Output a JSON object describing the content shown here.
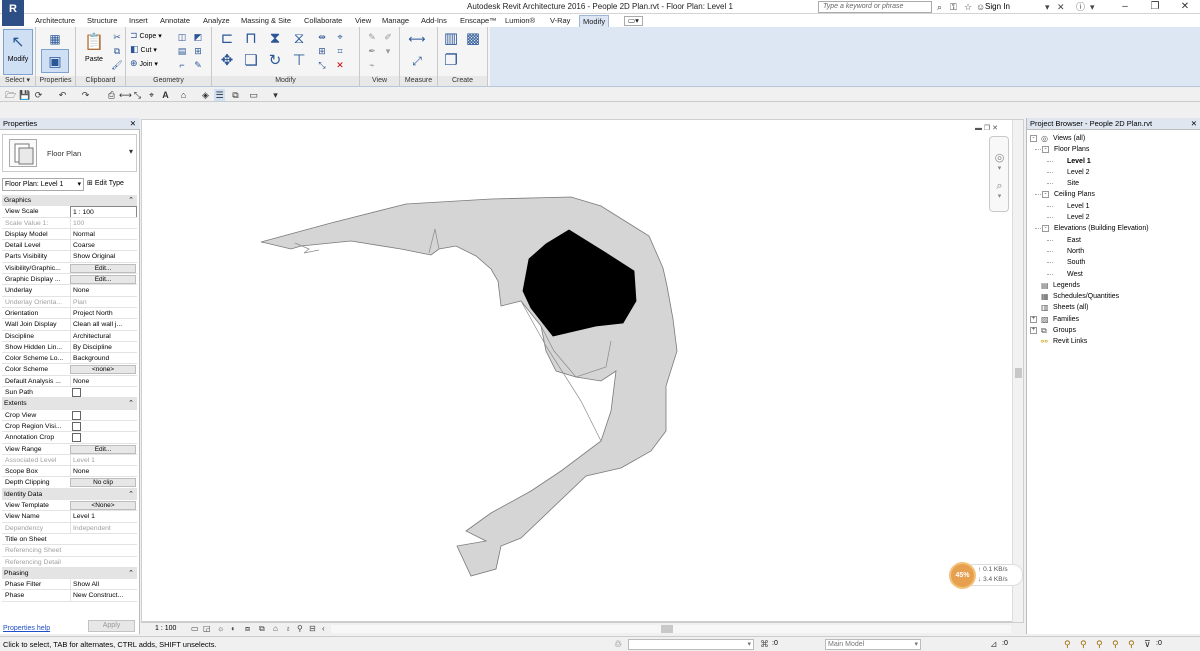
{
  "window": {
    "title": "Autodesk Revit Architecture 2016 -    People 2D Plan.rvt - Floor Plan: Level 1",
    "logo": "R",
    "search_placeholder": "Type a keyword or phrase",
    "sign_in": "Sign In"
  },
  "ribbon_tabs": [
    {
      "label": "Architecture",
      "active": false
    },
    {
      "label": "Structure",
      "active": false
    },
    {
      "label": "Insert",
      "active": false
    },
    {
      "label": "Annotate",
      "active": false
    },
    {
      "label": "Analyze",
      "active": false
    },
    {
      "label": "Massing & Site",
      "active": false
    },
    {
      "label": "Collaborate",
      "active": false
    },
    {
      "label": "View",
      "active": false
    },
    {
      "label": "Manage",
      "active": false
    },
    {
      "label": "Add-Ins",
      "active": false
    },
    {
      "label": "Enscape™",
      "active": false
    },
    {
      "label": "Lumion®",
      "active": false
    },
    {
      "label": "V-Ray",
      "active": false
    },
    {
      "label": "Modify",
      "active": true
    }
  ],
  "ribbon": {
    "modify_label": "Modify",
    "paste_label": "Paste",
    "cope_label": "Cope",
    "cut_label": "Cut",
    "join_label": "Join",
    "groups": {
      "select": "Select",
      "properties": "Properties",
      "clipboard": "Clipboard",
      "geometry": "Geometry",
      "modify": "Modify",
      "view": "View",
      "measure": "Measure",
      "create": "Create"
    }
  },
  "properties": {
    "title": "Properties",
    "type_name": "Floor Plan",
    "instance": "Floor Plan: Level 1",
    "edit_type": "Edit Type",
    "rows": [
      {
        "kind": "section",
        "label": "Graphics"
      },
      {
        "kind": "input",
        "key": "View Scale",
        "value": "1 : 100"
      },
      {
        "kind": "dim",
        "key": "Scale Value    1:",
        "value": "100"
      },
      {
        "kind": "text",
        "key": "Display Model",
        "value": "Normal"
      },
      {
        "kind": "text",
        "key": "Detail Level",
        "value": "Coarse"
      },
      {
        "kind": "text",
        "key": "Parts Visibility",
        "value": "Show Original"
      },
      {
        "kind": "button",
        "key": "Visibility/Graphic...",
        "value": "Edit..."
      },
      {
        "kind": "button",
        "key": "Graphic Display ...",
        "value": "Edit..."
      },
      {
        "kind": "text",
        "key": "Underlay",
        "value": "None"
      },
      {
        "kind": "dim",
        "key": "Underlay Orienta...",
        "value": "Plan"
      },
      {
        "kind": "text",
        "key": "Orientation",
        "value": "Project North"
      },
      {
        "kind": "text",
        "key": "Wall Join Display",
        "value": "Clean all wall j..."
      },
      {
        "kind": "text",
        "key": "Discipline",
        "value": "Architectural"
      },
      {
        "kind": "text",
        "key": "Show Hidden Lin...",
        "value": "By Discipline"
      },
      {
        "kind": "text",
        "key": "Color Scheme Lo...",
        "value": "Background"
      },
      {
        "kind": "button",
        "key": "Color Scheme",
        "value": "<none>"
      },
      {
        "kind": "text",
        "key": "Default Analysis ...",
        "value": "None"
      },
      {
        "kind": "check",
        "key": "Sun Path",
        "value": ""
      },
      {
        "kind": "section",
        "label": "Extents"
      },
      {
        "kind": "check",
        "key": "Crop View",
        "value": ""
      },
      {
        "kind": "check",
        "key": "Crop Region Visi...",
        "value": ""
      },
      {
        "kind": "check",
        "key": "Annotation Crop",
        "value": ""
      },
      {
        "kind": "button",
        "key": "View Range",
        "value": "Edit..."
      },
      {
        "kind": "dim",
        "key": "Associated Level",
        "value": "Level 1"
      },
      {
        "kind": "text",
        "key": "Scope Box",
        "value": "None"
      },
      {
        "kind": "button",
        "key": "Depth Clipping",
        "value": "No clip"
      },
      {
        "kind": "section",
        "label": "Identity Data"
      },
      {
        "kind": "button",
        "key": "View Template",
        "value": "<None>"
      },
      {
        "kind": "text",
        "key": "View Name",
        "value": "Level 1"
      },
      {
        "kind": "dim",
        "key": "Dependency",
        "value": "Independent"
      },
      {
        "kind": "text",
        "key": "Title on Sheet",
        "value": ""
      },
      {
        "kind": "dim",
        "key": "Referencing Sheet",
        "value": ""
      },
      {
        "kind": "dim",
        "key": "Referencing Detail",
        "value": ""
      },
      {
        "kind": "section",
        "label": "Phasing"
      },
      {
        "kind": "text",
        "key": "Phase Filter",
        "value": "Show All"
      },
      {
        "kind": "text",
        "key": "Phase",
        "value": "New Construct..."
      }
    ],
    "help_link": "Properties help",
    "apply": "Apply"
  },
  "canvas": {
    "scale": "1 : 100",
    "network": {
      "percent": "45%",
      "up": "0.1 KB/s",
      "down": "3.4 KB/s"
    }
  },
  "browser": {
    "title": "Project Browser - People 2D Plan.rvt",
    "tree": [
      {
        "label": "Views (all)",
        "level": 0,
        "exp": "-",
        "icon": "views",
        "bold": false
      },
      {
        "label": "Floor Plans",
        "level": 1,
        "exp": "-",
        "icon": "",
        "bold": false
      },
      {
        "label": "Level 1",
        "level": 2,
        "exp": "",
        "icon": "",
        "bold": true
      },
      {
        "label": "Level 2",
        "level": 2,
        "exp": "",
        "icon": "",
        "bold": false
      },
      {
        "label": "Site",
        "level": 2,
        "exp": "",
        "icon": "",
        "bold": false
      },
      {
        "label": "Ceiling Plans",
        "level": 1,
        "exp": "-",
        "icon": "",
        "bold": false
      },
      {
        "label": "Level 1",
        "level": 2,
        "exp": "",
        "icon": "",
        "bold": false
      },
      {
        "label": "Level 2",
        "level": 2,
        "exp": "",
        "icon": "",
        "bold": false
      },
      {
        "label": "Elevations (Building Elevation)",
        "level": 1,
        "exp": "-",
        "icon": "",
        "bold": false
      },
      {
        "label": "East",
        "level": 2,
        "exp": "",
        "icon": "",
        "bold": false
      },
      {
        "label": "North",
        "level": 2,
        "exp": "",
        "icon": "",
        "bold": false
      },
      {
        "label": "South",
        "level": 2,
        "exp": "",
        "icon": "",
        "bold": false
      },
      {
        "label": "West",
        "level": 2,
        "exp": "",
        "icon": "",
        "bold": false
      },
      {
        "label": "Legends",
        "level": 0,
        "exp": "",
        "icon": "legend",
        "bold": false
      },
      {
        "label": "Schedules/Quantities",
        "level": 0,
        "exp": "",
        "icon": "schedule",
        "bold": false
      },
      {
        "label": "Sheets (all)",
        "level": 0,
        "exp": "",
        "icon": "sheet",
        "bold": false
      },
      {
        "label": "Families",
        "level": 0,
        "exp": "+",
        "icon": "family",
        "bold": false
      },
      {
        "label": "Groups",
        "level": 0,
        "exp": "+",
        "icon": "group",
        "bold": false
      },
      {
        "label": "Revit Links",
        "level": 0,
        "exp": "",
        "icon": "link",
        "bold": false
      }
    ]
  },
  "status": {
    "message": "Click to select, TAB for alternates, CTRL adds, SHIFT unselects.",
    "zero_a": ":0",
    "model": "Main Model",
    "zero_b": ":0"
  }
}
